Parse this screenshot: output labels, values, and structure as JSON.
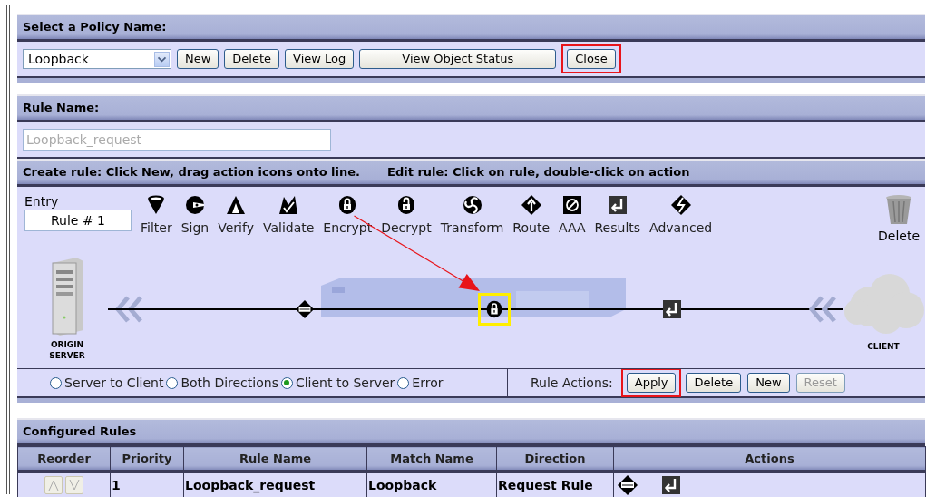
{
  "policy_panel": {
    "heading": "Select a Policy Name:",
    "policy_select": {
      "value": "Loopback"
    },
    "buttons": [
      {
        "label": "New",
        "highlighted": false
      },
      {
        "label": "Delete",
        "highlighted": false
      },
      {
        "label": "View Log",
        "highlighted": false
      },
      {
        "label": "View Object Status",
        "highlighted": false
      },
      {
        "label": "Close",
        "highlighted": true
      }
    ]
  },
  "rule_panel": {
    "heading": "Rule Name:",
    "rule_name": {
      "value": "Loopback_request",
      "disabled": true
    },
    "instructions": [
      "Create rule: Click New, drag action icons onto line.",
      "Edit rule: Click on rule, double-click on action"
    ],
    "entry": {
      "label": "Entry",
      "value": "Rule # 1"
    },
    "actions": [
      {
        "kind": "filter",
        "label": "Filter"
      },
      {
        "kind": "sign",
        "label": "Sign"
      },
      {
        "kind": "verify",
        "label": "Verify"
      },
      {
        "kind": "validate",
        "label": "Validate"
      },
      {
        "kind": "encrypt",
        "label": "Encrypt"
      },
      {
        "kind": "decrypt",
        "label": "Decrypt"
      },
      {
        "kind": "transform",
        "label": "Transform"
      },
      {
        "kind": "route",
        "label": "Route"
      },
      {
        "kind": "aaa",
        "label": "AAA"
      },
      {
        "kind": "results",
        "label": "Results"
      },
      {
        "kind": "advanced",
        "label": "Advanced"
      }
    ],
    "trash_label": "Delete",
    "flow": {
      "server_label": "ORIGIN SERVER",
      "client_label": "CLIENT",
      "steps": [
        {
          "kind": "match",
          "selected": false
        },
        {
          "kind": "encrypt",
          "selected": true
        },
        {
          "kind": "results",
          "selected": false
        }
      ]
    },
    "directions": [
      {
        "label": "Server to Client",
        "selected": false
      },
      {
        "label": "Both Directions",
        "selected": false
      },
      {
        "label": "Client to Server",
        "selected": true
      },
      {
        "label": "Error",
        "selected": false
      }
    ],
    "rule_actions_label": "Rule Actions:",
    "rule_actions": [
      {
        "label": "Apply",
        "highlighted": true,
        "disabled": false
      },
      {
        "label": "Delete",
        "highlighted": false,
        "disabled": false
      },
      {
        "label": "New",
        "highlighted": false,
        "disabled": false
      },
      {
        "label": "Reset",
        "highlighted": false,
        "disabled": true
      }
    ]
  },
  "configured_rules": {
    "heading": "Configured Rules",
    "columns": [
      "Reorder",
      "Priority",
      "Rule Name",
      "Match Name",
      "Direction",
      "Actions"
    ],
    "rows": [
      {
        "priority": "1",
        "rule_name": "Loopback_request",
        "match_name": "Loopback",
        "direction": "Request Rule",
        "actions": [
          {
            "kind": "match"
          },
          {
            "kind": "results"
          }
        ]
      }
    ]
  }
}
